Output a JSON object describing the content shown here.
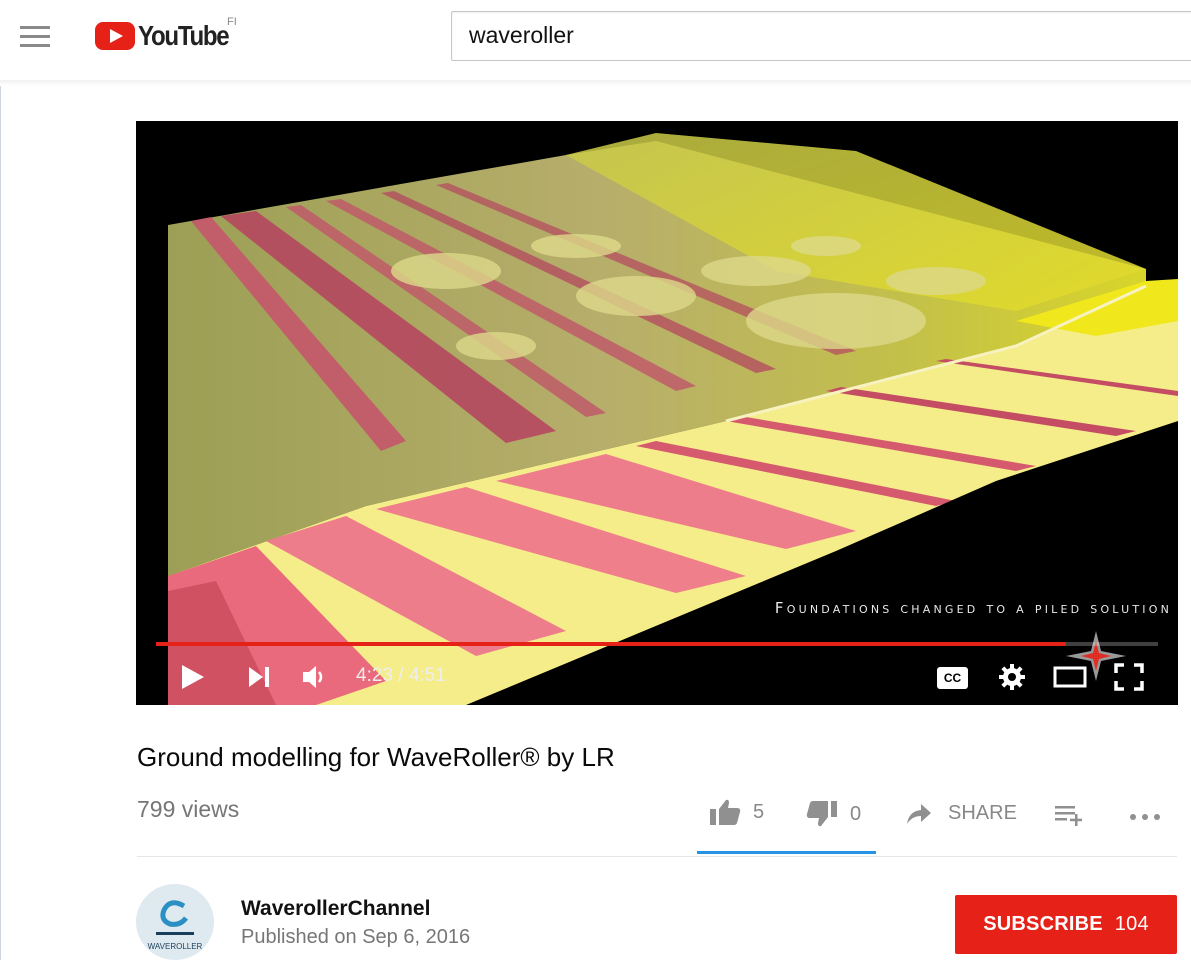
{
  "masthead": {
    "logo_text": "YouTube",
    "country_code": "FI",
    "search_value": "waveroller"
  },
  "player": {
    "caption_overlay": "Foundations changed to a piled solution",
    "progress_fraction": 0.908,
    "current_time": "4:23",
    "duration": "4:51",
    "time_display": "4:23 / 4:51",
    "cc_label": "CC",
    "accent_color": "#e62117"
  },
  "video": {
    "title": "Ground modelling for WaveRoller® by LR",
    "views": "799 views"
  },
  "actions": {
    "likes": "5",
    "dislikes": "0",
    "share_label": "SHARE"
  },
  "owner": {
    "channel_name": "WaverollerChannel",
    "published": "Published on Sep 6, 2016",
    "avatar_text": "WAVEROLLER",
    "subscribe_label": "SUBSCRIBE",
    "subscriber_count": "104"
  },
  "icons": {
    "menu": "hamburger-icon",
    "play": "play-icon",
    "next": "next-icon",
    "volume": "volume-icon",
    "captions": "cc-icon",
    "settings": "gear-icon",
    "theater": "theater-icon",
    "fullscreen": "fullscreen-icon",
    "like": "thumbs-up-icon",
    "dislike": "thumbs-down-icon",
    "share": "share-arrow-icon",
    "add_to": "add-to-playlist-icon",
    "more": "more-icon"
  }
}
